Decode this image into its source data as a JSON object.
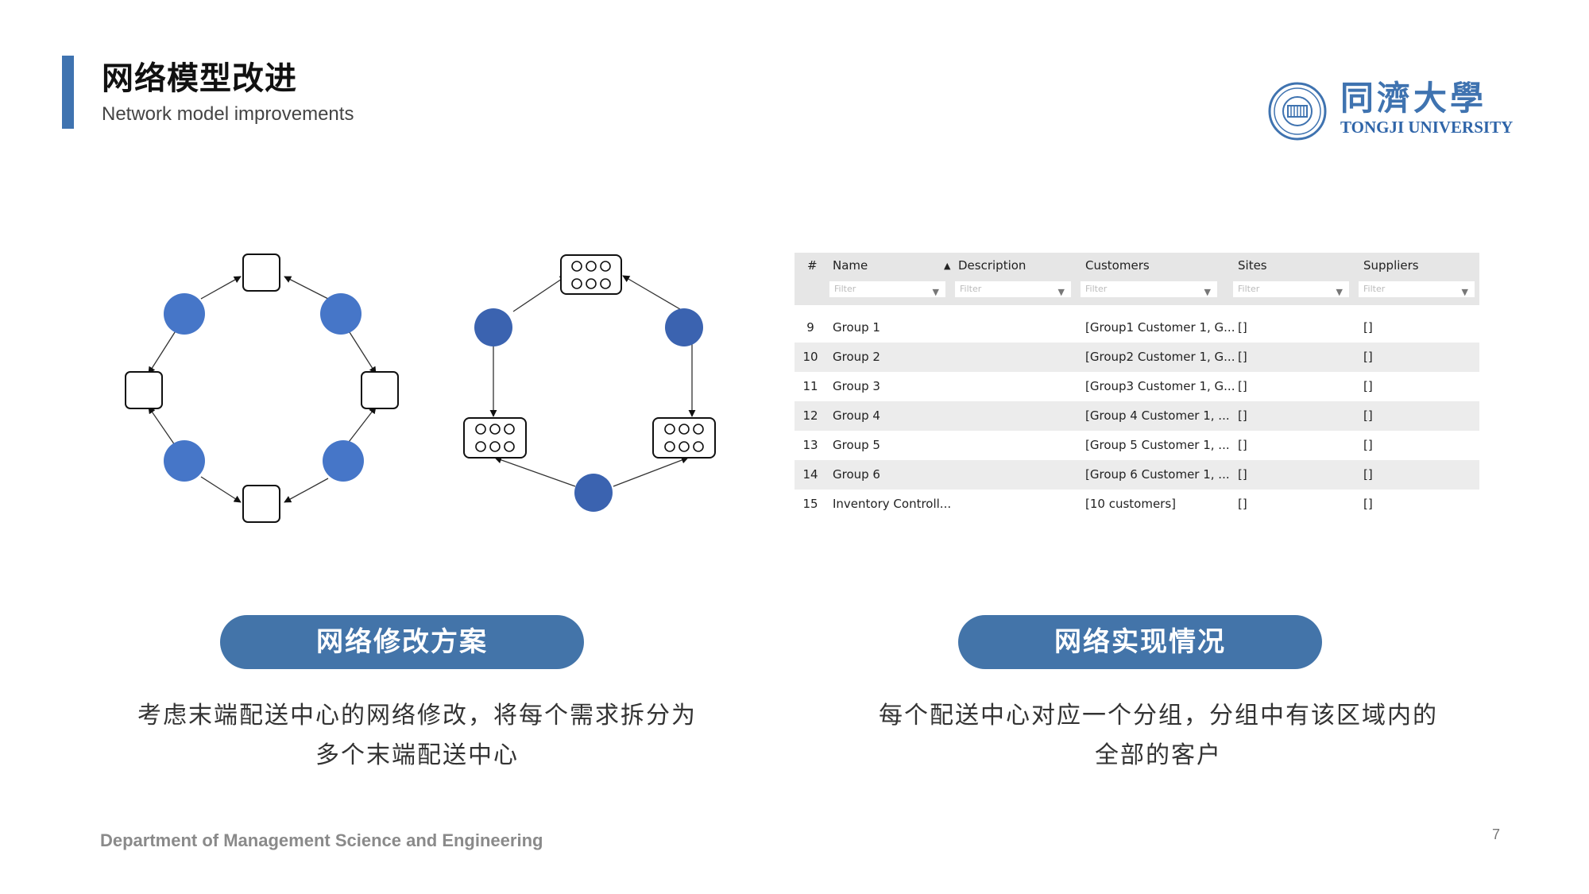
{
  "header": {
    "title_cn": "网络模型改进",
    "title_en": "Network model improvements"
  },
  "logo": {
    "name_cn": "同濟大學",
    "name_en": "TONGJI UNIVERSITY"
  },
  "table": {
    "columns": [
      "#",
      "Name",
      "Description",
      "Customers",
      "Sites",
      "Suppliers"
    ],
    "filter_placeholder": "Filter",
    "rows": [
      {
        "num": "9",
        "name": "Group 1",
        "customers": "[Group1 Customer 1, G...",
        "sites": "[]",
        "suppliers": "[]"
      },
      {
        "num": "10",
        "name": "Group 2",
        "customers": "[Group2 Customer 1, G...",
        "sites": "[]",
        "suppliers": "[]"
      },
      {
        "num": "11",
        "name": "Group 3",
        "customers": "[Group3 Customer 1, G...",
        "sites": "[]",
        "suppliers": "[]"
      },
      {
        "num": "12",
        "name": "Group 4",
        "customers": "[Group 4 Customer 1, ...",
        "sites": "[]",
        "suppliers": "[]"
      },
      {
        "num": "13",
        "name": "Group 5",
        "customers": "[Group 5 Customer 1, ...",
        "sites": "[]",
        "suppliers": "[]"
      },
      {
        "num": "14",
        "name": "Group 6",
        "customers": "[Group 6 Customer 1, ...",
        "sites": "[]",
        "suppliers": "[]"
      },
      {
        "num": "15",
        "name": "Inventory Controll...",
        "customers": "[10 customers]",
        "sites": "[]",
        "suppliers": "[]"
      }
    ]
  },
  "left_panel": {
    "pill_label": "网络修改方案",
    "desc_line1": "考虑末端配送中心的网络修改，将每个需求拆分为",
    "desc_line2": "多个末端配送中心"
  },
  "right_panel": {
    "pill_label": "网络实现情况",
    "desc_line1": "每个配送中心对应一个分组，分组中有该区域内的",
    "desc_line2": "全部的客户"
  },
  "footer": {
    "department": "Department of Management Science and Engineering",
    "page_number": "7"
  },
  "colors": {
    "accent": "#3f73b0",
    "pill": "#4374a9",
    "node_left": "#4676c8",
    "node_right": "#3b63b0"
  }
}
